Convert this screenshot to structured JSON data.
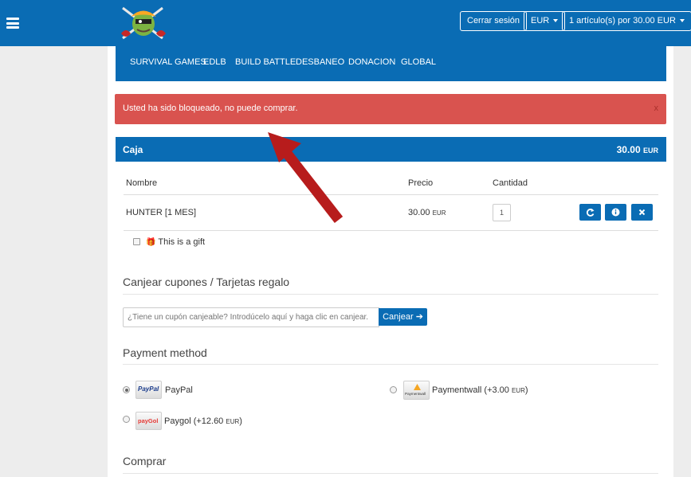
{
  "header": {
    "logout_label": "Cerrar sesión",
    "currency_label": "EUR",
    "cart_label": "1 artículo(s) por 30.00 EUR",
    "menu_icon": "hamburger-icon",
    "logo_icon": "pirate-logo"
  },
  "nav": {
    "items": [
      "SURVIVAL GAMES",
      "EDLB",
      "BUILD BATTLE",
      "DESBANEO",
      "DONACION",
      "GLOBAL"
    ]
  },
  "alert": {
    "message": "Usted ha sido bloqueado, no puede comprar.",
    "close": "x",
    "color": "#d9534f"
  },
  "cart": {
    "title": "Caja",
    "total_amount": "30.00",
    "total_currency": "EUR",
    "columns": [
      "Nombre",
      "Precio",
      "Cantidad"
    ],
    "items": [
      {
        "name": "HUNTER [1 MES]",
        "price": "30.00",
        "currency": "EUR",
        "quantity": "1"
      }
    ],
    "actions": [
      "refresh-icon",
      "info-icon",
      "remove-icon"
    ],
    "gift_label": "This is a gift"
  },
  "coupon": {
    "title": "Canjear cupones / Tarjetas regalo",
    "placeholder": "¿Tiene un cupón canjeable? Introdúcelo aquí y haga clic en canjear.",
    "button": "Canjear"
  },
  "payment": {
    "title": "Payment method",
    "methods": [
      {
        "label": "PayPal",
        "logo": "PayPal",
        "selected": true
      },
      {
        "label": "Paymentwall (+3.00 ",
        "suffix": "EUR",
        "tail": ")",
        "logo": "Paymentwall",
        "selected": false
      },
      {
        "label": "Paygol (+12.60 ",
        "suffix": "EUR",
        "tail": ")",
        "logo": "payGol",
        "selected": false
      }
    ]
  },
  "purchase": {
    "title": "Comprar"
  },
  "colors": {
    "brand": "#0a6cb4",
    "alert": "#d9534f",
    "annotation_arrow": "#b71c1c"
  }
}
